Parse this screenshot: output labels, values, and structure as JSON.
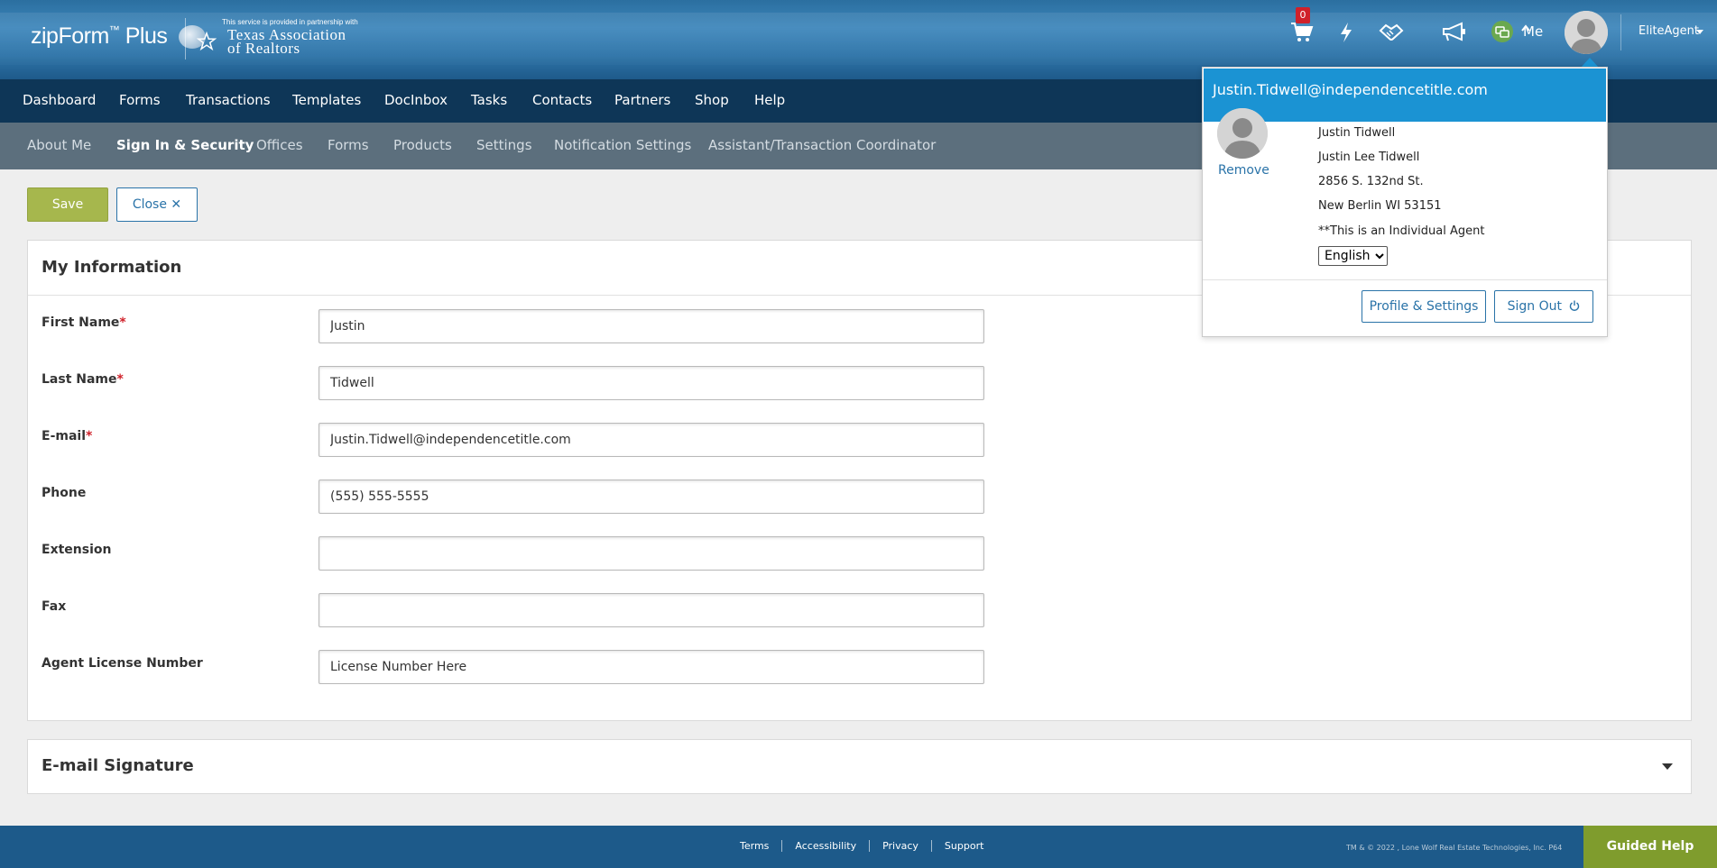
{
  "header": {
    "logo_text": "zipForm",
    "logo_plus": " Plus",
    "partner_small": "This service is provided in partnership with",
    "partner_line1": "Texas Association",
    "partner_line2": "of Realtors",
    "cart_count": "0",
    "me_label": "Me",
    "account_name": "EliteAgent",
    "icons": [
      "cart-icon",
      "lightning-icon",
      "handshake-icon",
      "megaphone-icon",
      "chat-icon",
      "chevron-up-icon",
      "avatar"
    ]
  },
  "main_nav": {
    "items": [
      {
        "label": "Dashboard"
      },
      {
        "label": "Forms"
      },
      {
        "label": "Transactions"
      },
      {
        "label": "Templates"
      },
      {
        "label": "DocInbox"
      },
      {
        "label": "Tasks"
      },
      {
        "label": "Contacts"
      },
      {
        "label": "Partners"
      },
      {
        "label": "Shop"
      },
      {
        "label": "Help"
      }
    ]
  },
  "sub_nav": {
    "items": [
      {
        "label": "About Me"
      },
      {
        "label": "Sign In & Security",
        "active": true
      },
      {
        "label": "Offices"
      },
      {
        "label": "Forms"
      },
      {
        "label": "Products"
      },
      {
        "label": "Settings"
      },
      {
        "label": "Notification Settings"
      },
      {
        "label": "Assistant/Transaction Coordinator"
      }
    ]
  },
  "actions": {
    "save_label": "Save",
    "close_label": "Close",
    "close_icon": "✕"
  },
  "my_info": {
    "title": "My Information",
    "fields": [
      {
        "label": "First Name",
        "required": "*",
        "value": "Justin"
      },
      {
        "label": "Last Name",
        "required": "*",
        "value": "Tidwell"
      },
      {
        "label": "E-mail",
        "required": "*",
        "value": "Justin.Tidwell@independencetitle.com"
      },
      {
        "label": "Phone",
        "required": "",
        "value": "(555) 555-5555"
      },
      {
        "label": "Extension",
        "required": "",
        "value": ""
      },
      {
        "label": "Fax",
        "required": "",
        "value": ""
      },
      {
        "label": "Agent License Number",
        "required": "",
        "value": "License Number Here"
      }
    ]
  },
  "signature": {
    "title": "E-mail Signature"
  },
  "footer": {
    "links": [
      "Terms",
      "Accessibility",
      "Privacy",
      "Support"
    ],
    "copyright": "TM & © 2022 , Lone Wolf Real Estate Technologies, Inc. P64",
    "guided_help": "Guided Help"
  },
  "profile_popup": {
    "email": "Justin.Tidwell@independencetitle.com",
    "remove_label": "Remove",
    "name": "Justin Tidwell",
    "full_name": "Justin Lee Tidwell",
    "address1": "2856 S. 132nd St.",
    "address2": "New Berlin WI 53151",
    "agent_type": "**This is an Individual Agent",
    "language": "English",
    "profile_button": "Profile & Settings",
    "signout_button": "Sign Out"
  },
  "colors": {
    "header_blue": "#2e74a8",
    "nav_dark": "#0e3657",
    "subnav_gray": "#5c6f7d",
    "save_green": "#a6b74d",
    "link_blue": "#2a73a8",
    "popup_blue": "#1b93d3",
    "required_red": "#d0212a",
    "guided_green": "#7f9c2d"
  }
}
